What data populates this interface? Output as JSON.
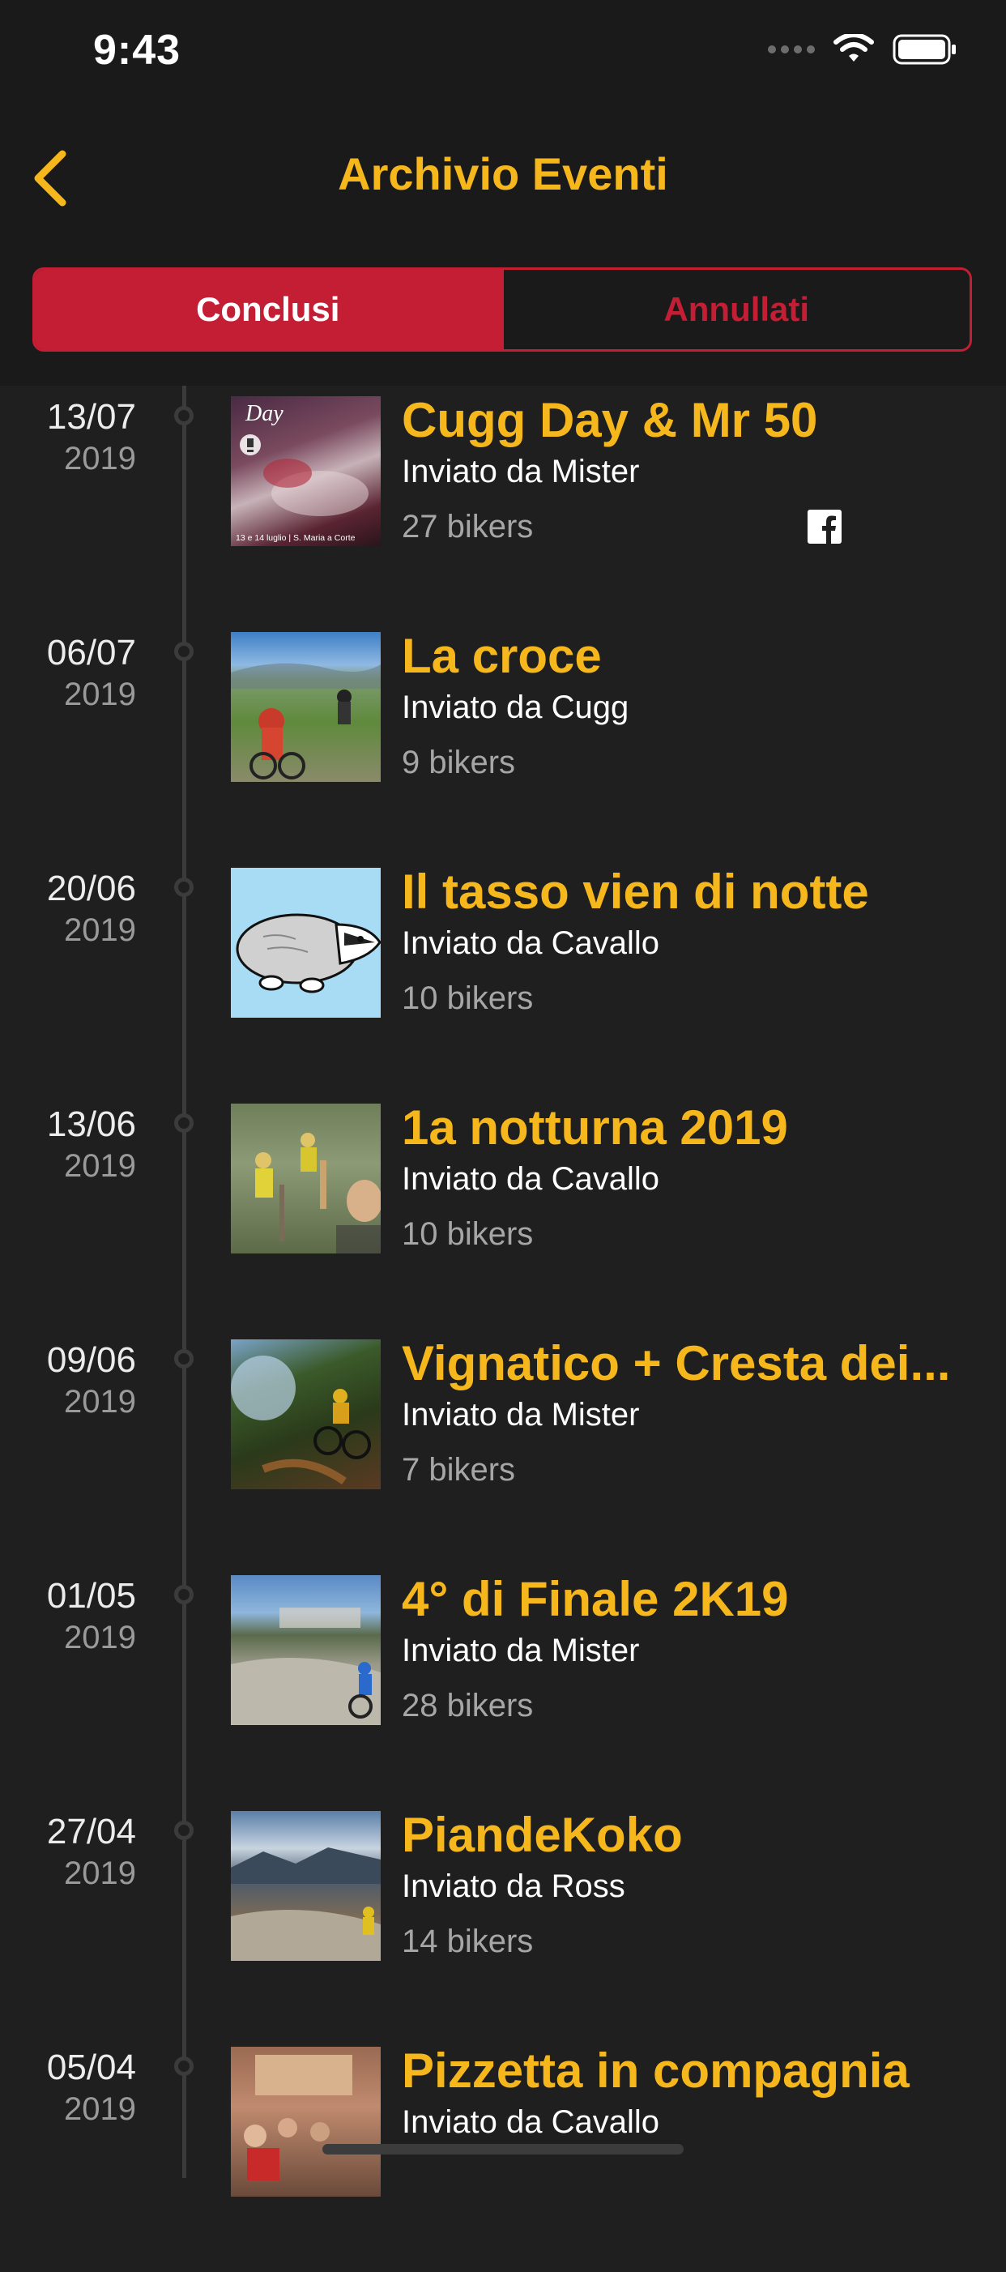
{
  "status_bar": {
    "time": "9:43"
  },
  "nav": {
    "title": "Archivio Eventi"
  },
  "segments": [
    {
      "label": "Conclusi",
      "active": true
    },
    {
      "label": "Annullati",
      "active": false
    }
  ],
  "events": [
    {
      "date": "13/07",
      "year": "2019",
      "title": "Cugg Day & Mr 50",
      "author": "Inviato da Mister",
      "bikers": "27 bikers",
      "thumb_overlay_1": "Day",
      "thumb_overlay_2": "13 e 14 luglio | S. Maria a Corte",
      "facebook": true
    },
    {
      "date": "06/07",
      "year": "2019",
      "title": "La croce",
      "author": "Inviato da Cugg",
      "bikers": "9 bikers"
    },
    {
      "date": "20/06",
      "year": "2019",
      "title": "Il tasso vien di notte",
      "author": "Inviato da Cavallo",
      "bikers": "10 bikers"
    },
    {
      "date": "13/06",
      "year": "2019",
      "title": "1a notturna 2019",
      "author": "Inviato da Cavallo",
      "bikers": "10 bikers"
    },
    {
      "date": "09/06",
      "year": "2019",
      "title": "Vignatico + Cresta dei...",
      "author": "Inviato da Mister",
      "bikers": "7 bikers"
    },
    {
      "date": "01/05",
      "year": "2019",
      "title": "4° di Finale 2K19",
      "author": "Inviato da Mister",
      "bikers": "28 bikers"
    },
    {
      "date": "27/04",
      "year": "2019",
      "title": "PiandeKoko",
      "author": "Inviato da Ross",
      "bikers": "14 bikers"
    },
    {
      "date": "05/04",
      "year": "2019",
      "title": "Pizzetta in compagnia",
      "author": "Inviato da Cavallo",
      "bikers": ""
    }
  ],
  "colors": {
    "accent": "#f6b71c",
    "segment_red": "#c41e35",
    "background": "#1f1f1f",
    "header_bg": "#1a1a1a"
  }
}
